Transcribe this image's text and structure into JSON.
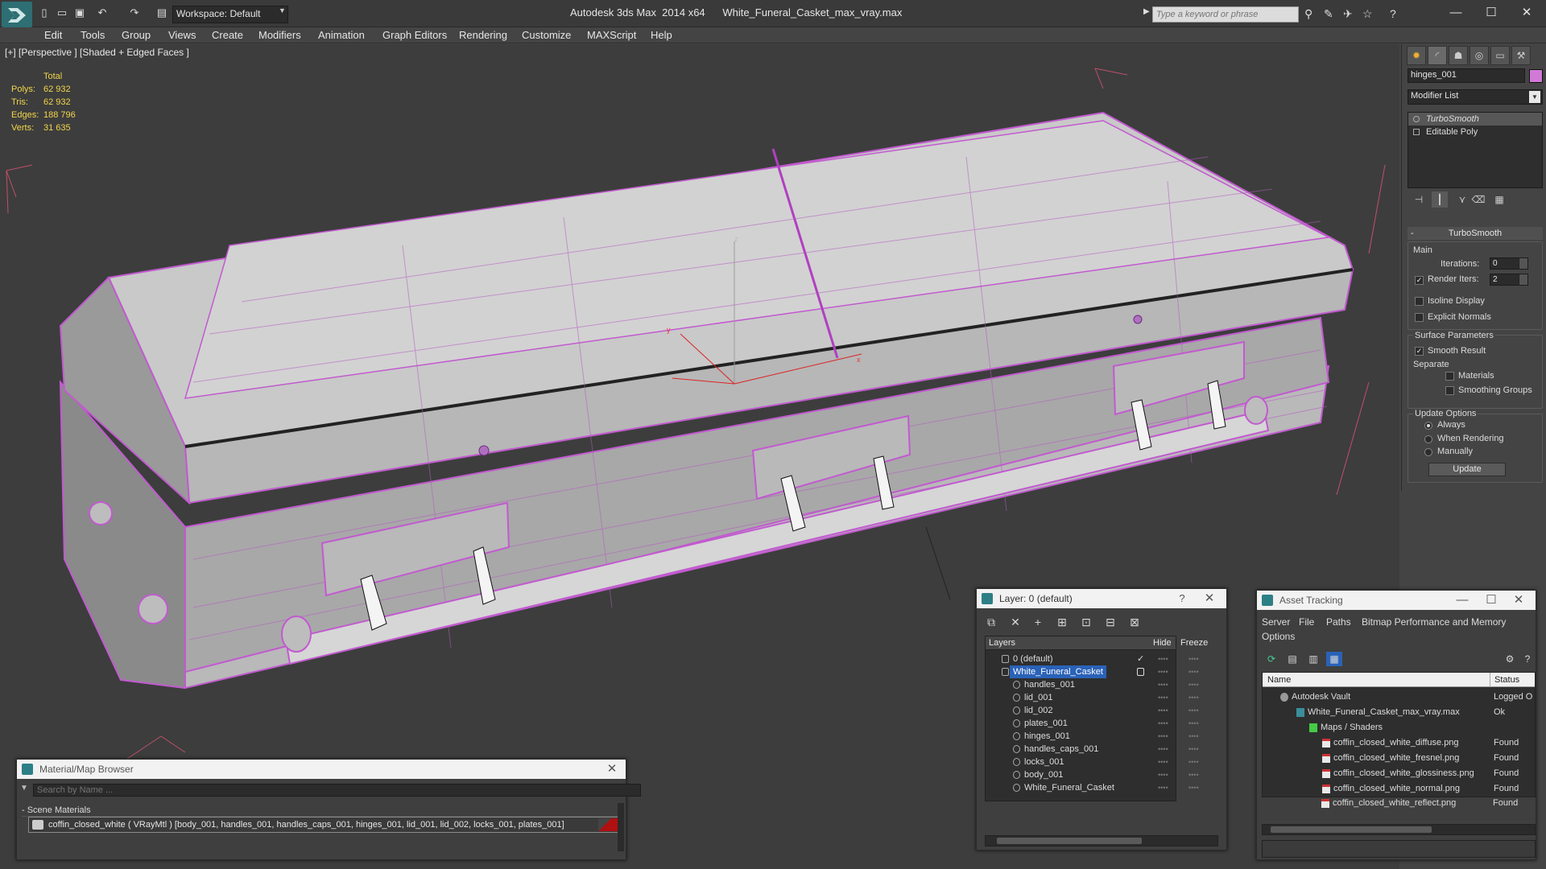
{
  "window": {
    "title": "Autodesk 3ds Max  2014 x64      White_Funeral_Casket_max_vray.max",
    "workspace": "Workspace: Default",
    "search_placeholder": "Type a keyword or phrase",
    "minimize": "—",
    "maximize": "☐",
    "close": "✕"
  },
  "menu": [
    "Edit",
    "Tools",
    "Group",
    "Views",
    "Create",
    "Modifiers",
    "Animation",
    "Graph Editors",
    "Rendering",
    "Customize",
    "MAXScript",
    "Help"
  ],
  "viewport": {
    "label": "[+] [Perspective ] [Shaded + Edged Faces ]",
    "stats": {
      "header": "Total",
      "rows": [
        {
          "key": "Polys:",
          "value": "62 932"
        },
        {
          "key": "Tris:",
          "value": "62 932"
        },
        {
          "key": "Edges:",
          "value": "188 796"
        },
        {
          "key": "Verts:",
          "value": "31 635"
        }
      ]
    },
    "axis": {
      "x": "x",
      "y": "y",
      "z": "z"
    }
  },
  "command_panel": {
    "object_name": "hinges_001",
    "object_color": "#d07ad8",
    "modifier_list": "Modifier List",
    "stack": [
      {
        "label": "TurboSmooth",
        "selected": true
      },
      {
        "label": "Editable Poly",
        "selected": false
      }
    ],
    "rollout_title": "TurboSmooth",
    "main_label": "Main",
    "iterations_label": "Iterations:",
    "iterations_value": "0",
    "render_iters_label": "Render Iters:",
    "render_iters_value": "2",
    "isoline_label": "Isoline Display",
    "explicit_normals_label": "Explicit Normals",
    "surface_params_label": "Surface Parameters",
    "smooth_result_label": "Smooth Result",
    "separate_label": "Separate",
    "materials_label": "Materials",
    "smoothing_groups_label": "Smoothing Groups",
    "update_options_label": "Update Options",
    "always_label": "Always",
    "when_rendering_label": "When Rendering",
    "manually_label": "Manually",
    "update_button": "Update"
  },
  "layer_window": {
    "title": "Layer: 0 (default)",
    "help": "?",
    "close": "✕",
    "columns": {
      "layers": "Layers",
      "hide": "Hide",
      "freeze": "Freeze"
    },
    "rows": [
      {
        "name": "0 (default)",
        "level": 0
      },
      {
        "name": "White_Funeral_Casket",
        "level": 0
      },
      {
        "name": "handles_001",
        "level": 1
      },
      {
        "name": "lid_001",
        "level": 1
      },
      {
        "name": "lid_002",
        "level": 1
      },
      {
        "name": "plates_001",
        "level": 1
      },
      {
        "name": "hinges_001",
        "level": 1
      },
      {
        "name": "handles_caps_001",
        "level": 1
      },
      {
        "name": "locks_001",
        "level": 1
      },
      {
        "name": "body_001",
        "level": 1
      },
      {
        "name": "White_Funeral_Casket",
        "level": 1
      }
    ]
  },
  "asset_tracking": {
    "title": "Asset Tracking",
    "menu": [
      "Server",
      "File",
      "Paths",
      "Bitmap Performance and Memory",
      "Options"
    ],
    "columns": {
      "name": "Name",
      "status": "Status"
    },
    "rows": [
      {
        "name": "Autodesk Vault",
        "status": "Logged O"
      },
      {
        "name": "White_Funeral_Casket_max_vray.max",
        "status": "Ok"
      },
      {
        "name": "Maps / Shaders",
        "status": ""
      },
      {
        "name": "coffin_closed_white_diffuse.png",
        "status": "Found"
      },
      {
        "name": "coffin_closed_white_fresnel.png",
        "status": "Found"
      },
      {
        "name": "coffin_closed_white_glossiness.png",
        "status": "Found"
      },
      {
        "name": "coffin_closed_white_normal.png",
        "status": "Found"
      },
      {
        "name": "coffin_closed_white_reflect.png",
        "status": "Found"
      }
    ]
  },
  "material_browser": {
    "title": "Material/Map Browser",
    "search_placeholder": "Search by Name ...",
    "group": "- Scene Materials",
    "item": "coffin_closed_white  ( VRayMtl ) [body_001, handles_001, handles_caps_001, hinges_001, lid_001, lid_002, locks_001, plates_001]"
  }
}
